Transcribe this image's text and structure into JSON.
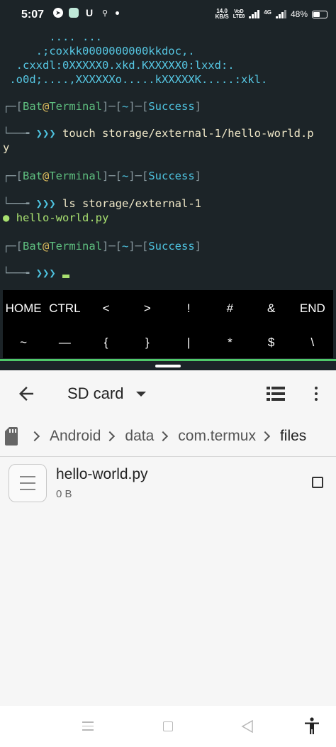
{
  "status_bar": {
    "time": "5:07",
    "speed_value": "14.0",
    "speed_unit": "KB/S",
    "volte_top": "VoD",
    "volte_bottom": "LTE8",
    "network": "4G",
    "battery": "48%",
    "battery_level": 0.48
  },
  "terminal": {
    "art_lines": [
      "       .... ...",
      "     .;coxkk0000000000kkdoc,.",
      "  .cxxdl:0XXXXX0.xkd.KXXXXX0:lxxd:.",
      " .o0d;....,XXXXXXo.....kXXXXXK.....:xkl."
    ],
    "prompt": {
      "user": "Bat",
      "at": "@",
      "host": "Terminal",
      "dir": "~",
      "status": "Success",
      "arrows": "❯❯❯"
    },
    "commands": [
      {
        "text": "touch storage/external-1/hello-world.p",
        "wrap": "y"
      },
      {
        "text": "ls storage/external-1",
        "output": "hello-world.py"
      }
    ]
  },
  "extra_keys": {
    "row1": [
      "HOME",
      "CTRL",
      "<",
      ">",
      "!",
      "#",
      "&",
      "END"
    ],
    "row2": [
      "~",
      "—",
      "{",
      "}",
      "|",
      "*",
      "$",
      "\\"
    ]
  },
  "file_manager": {
    "title": "SD card",
    "breadcrumb": [
      "Android",
      "data",
      "com.termux",
      "files"
    ],
    "files": [
      {
        "name": "hello-world.py",
        "size": "0 B"
      }
    ]
  },
  "icons": {
    "back": "arrow-left-icon",
    "dropdown": "caret-down-icon",
    "list_view": "list-view-icon",
    "overflow": "more-vert-icon",
    "sd": "sd-card-icon",
    "file": "document-icon"
  },
  "colors": {
    "terminal_bg": "#1c2428",
    "accent_green": "#4fc96a",
    "prompt_cyan": "#4ec3e0",
    "output_green": "#a8e070"
  }
}
